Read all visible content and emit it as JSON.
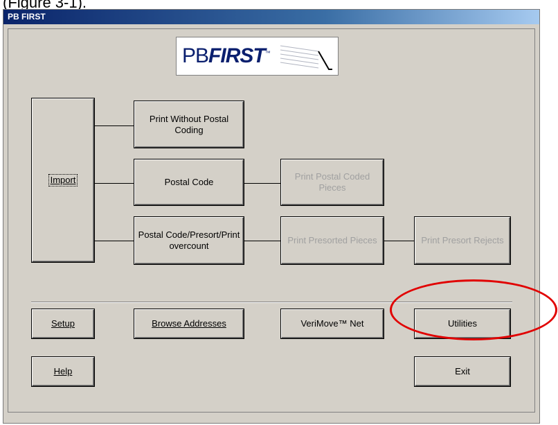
{
  "caption": "(Figure 3-1).",
  "window": {
    "title": "PB FIRST"
  },
  "logo": {
    "text_pb": "PB",
    "text_first": "FIRST",
    "tm": "™"
  },
  "buttons": {
    "import": "Import",
    "print_without_postal": "Print Without Postal Coding",
    "postal_code": "Postal Code",
    "print_postal_coded": "Print Postal Coded Pieces",
    "postal_presort_print": "Postal Code/Presort/Print overcount",
    "print_presorted": "Print Presorted Pieces",
    "print_presort_rejects": "Print Presort Rejects",
    "setup": "Setup",
    "browse_addresses": "Browse Addresses",
    "verimove": "VeriMove™ Net",
    "utilities": "Utilities",
    "help": "Help",
    "exit": "Exit"
  },
  "colors": {
    "annotation_ellipse": "#e10000",
    "titlebar": "#0a246a"
  }
}
